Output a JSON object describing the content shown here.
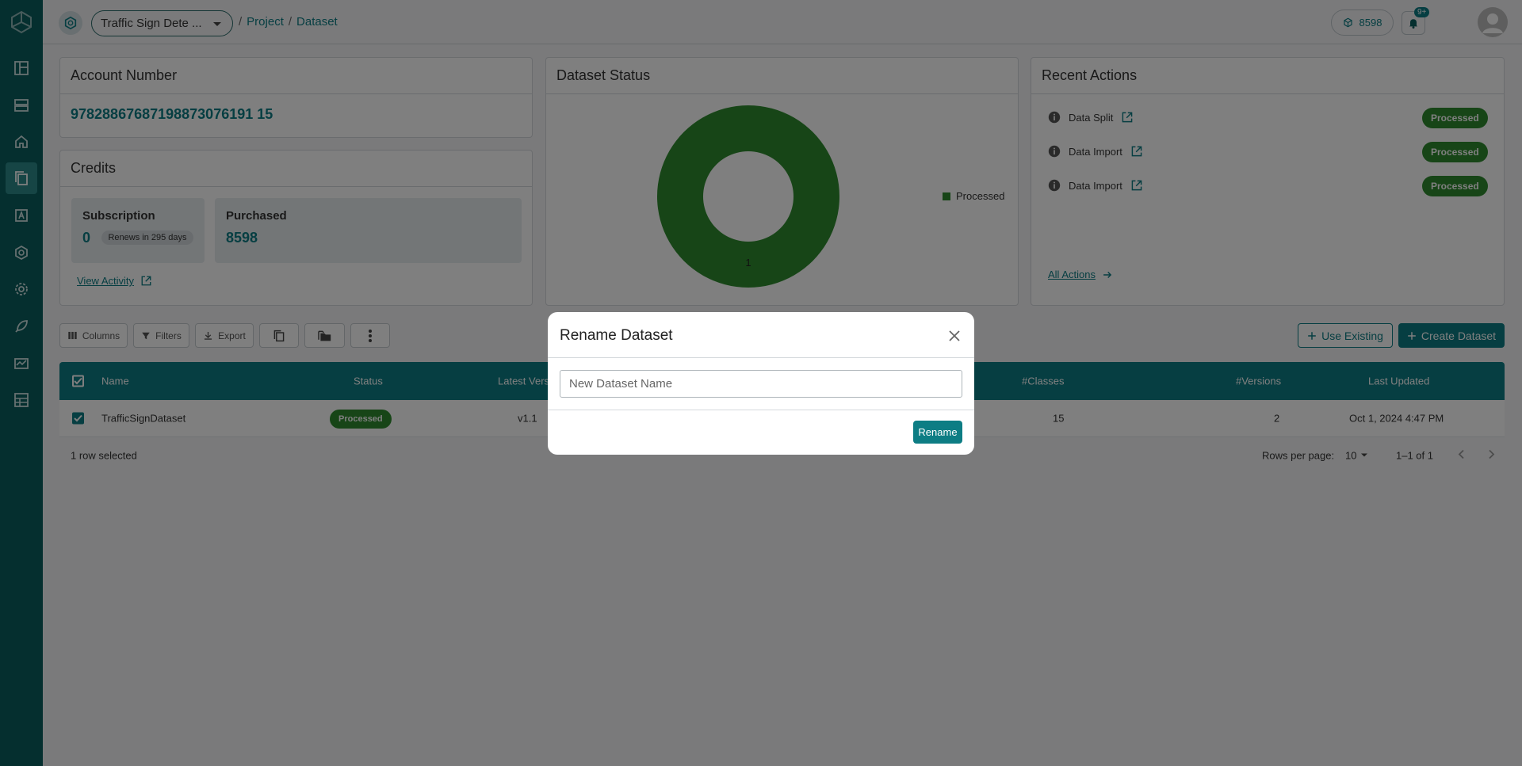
{
  "app": {
    "project_select": "Traffic Sign Dete ...",
    "breadcrumb": [
      "Project",
      "Dataset"
    ],
    "credits_pill": "8598",
    "notifications_badge": "9+"
  },
  "sidebar": {
    "items": [
      "dashboard",
      "datasets-list",
      "home",
      "datasets",
      "annotate",
      "models",
      "settings",
      "deploy",
      "monitoring",
      "reports"
    ],
    "active": "datasets"
  },
  "account": {
    "title": "Account Number",
    "number": "97828867687198873076191 15"
  },
  "credits": {
    "title": "Credits",
    "subscription_label": "Subscription",
    "subscription_value": "0",
    "renews": "Renews in 295 days",
    "purchased_label": "Purchased",
    "purchased_value": "8598",
    "view_activity": "View Activity"
  },
  "dataset_status": {
    "title": "Dataset Status",
    "legend": "Processed",
    "slice_label": "1"
  },
  "chart_data": {
    "type": "pie",
    "title": "Dataset Status",
    "categories": [
      "Processed"
    ],
    "values": [
      1
    ],
    "legend_position": "right"
  },
  "recent_actions": {
    "title": "Recent Actions",
    "items": [
      {
        "name": "Data Split",
        "status": "Processed"
      },
      {
        "name": "Data Import",
        "status": "Processed"
      },
      {
        "name": "Data Import",
        "status": "Processed"
      }
    ],
    "all_actions": "All Actions"
  },
  "toolbar": {
    "columns": "Columns",
    "filters": "Filters",
    "export": "Export",
    "use_existing": "Use Existing",
    "create_dataset": "Create Dataset"
  },
  "table": {
    "headers": {
      "name": "Name",
      "status": "Status",
      "latest_version": "Latest Vers",
      "classes": "#Classes",
      "versions": "#Versions",
      "last_updated": "Last Updated"
    },
    "rows": [
      {
        "name": "TrafficSignDataset",
        "status": "Processed",
        "latest_version": "v1.1",
        "classes": "15",
        "versions": "2",
        "last_updated": "Oct 1, 2024 4:47 PM"
      }
    ],
    "selected_text": "1 row selected",
    "rows_per_page_label": "Rows per page:",
    "rows_per_page": "10",
    "pagination": "1–1 of 1"
  },
  "modal": {
    "title": "Rename Dataset",
    "input_placeholder": "New Dataset Name",
    "input_value": "",
    "button": "Rename"
  },
  "colors": {
    "primary": "#0d7d84",
    "sidebar": "#0a5e5e",
    "processed": "#2e8b2e"
  }
}
